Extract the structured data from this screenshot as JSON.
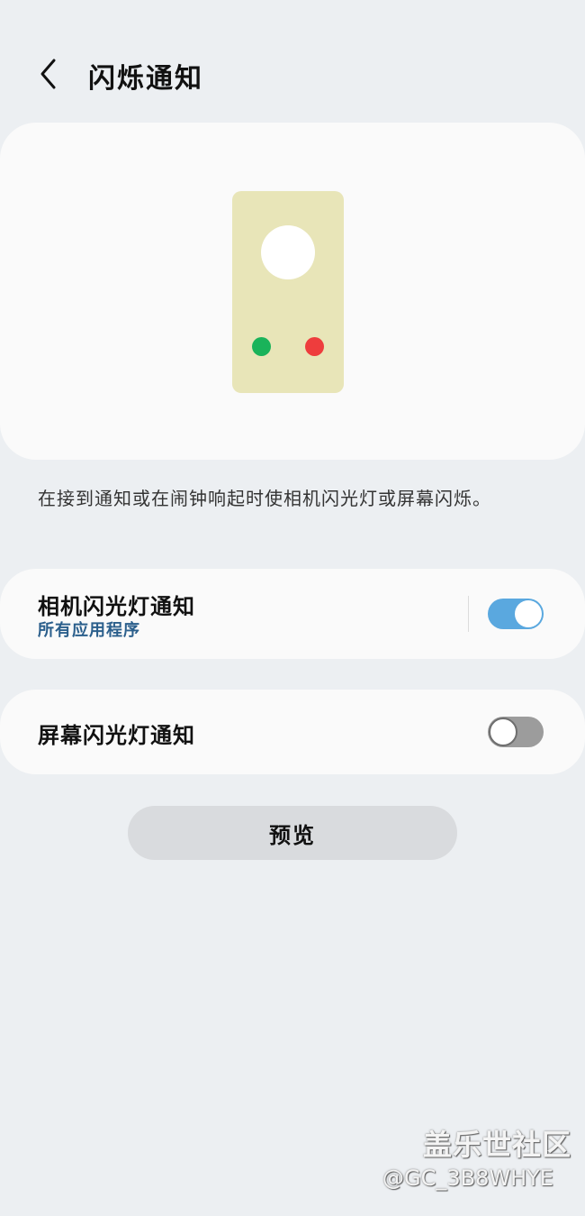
{
  "header": {
    "title": "闪烁通知",
    "back_icon": "chevron-left-icon"
  },
  "illustration": {
    "phone_color": "#e8e5b8",
    "indicator_colors": [
      "#1ab35a",
      "#ee3d3d"
    ]
  },
  "description": "在接到通知或在闹钟响起时使相机闪光灯或屏幕闪烁。",
  "settings": {
    "camera_flash": {
      "title": "相机闪光灯通知",
      "subtitle": "所有应用程序",
      "enabled": true
    },
    "screen_flash": {
      "title": "屏幕闪光灯通知",
      "enabled": false
    }
  },
  "preview_button": "预览",
  "watermark": {
    "title": "盖乐世社区",
    "handle": "@GC_3B8WHYE"
  },
  "colors": {
    "accent": "#5aa8df",
    "subtitle": "#2b5f8c",
    "background": "#eceff2"
  }
}
